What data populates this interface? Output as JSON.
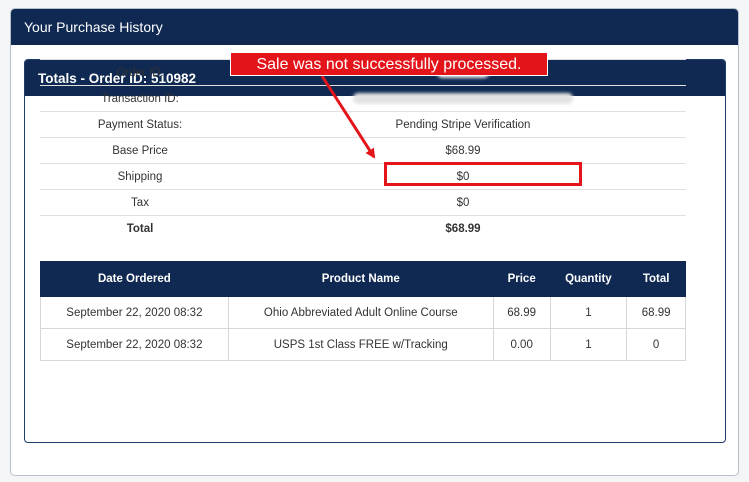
{
  "panel": {
    "title": "Your Purchase History"
  },
  "order_card": {
    "title": "Totals - Order ID: 510982"
  },
  "totals": {
    "order_id_label": "Order ID:",
    "transaction_id_label": "Transaction ID:",
    "payment_status_label": "Payment Status:",
    "payment_status_value": "Pending Stripe Verification",
    "base_price_label": "Base Price",
    "base_price_value": "$68.99",
    "shipping_label": "Shipping",
    "shipping_value": "$0",
    "tax_label": "Tax",
    "tax_value": "$0",
    "total_label": "Total",
    "total_value": "$68.99"
  },
  "products_table": {
    "headers": [
      "Date Ordered",
      "Product Name",
      "Price",
      "Quantity",
      "Total"
    ],
    "rows": [
      [
        "September 22, 2020 08:32",
        "Ohio Abbreviated Adult Online Course",
        "68.99",
        "1",
        "68.99"
      ],
      [
        "September 22, 2020 08:32",
        "USPS 1st Class FREE w/Tracking",
        "0.00",
        "1",
        "0"
      ]
    ]
  },
  "annotation": {
    "text": "Sale was not successfully processed.",
    "color": "#e3141a"
  },
  "colors": {
    "header_navy": "#0f2952",
    "annotation_red": "#e3141a"
  }
}
